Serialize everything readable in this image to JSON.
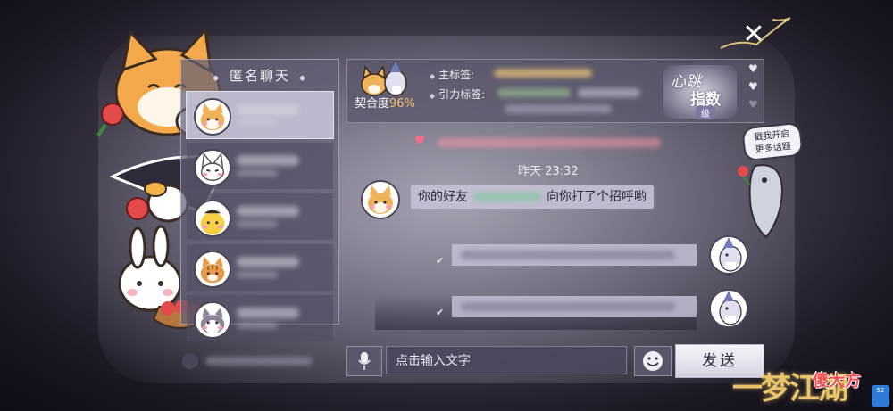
{
  "anonymous_chat": {
    "title": "匿名聊天",
    "contacts": [
      {
        "avatar": "shiba-dog-avatar",
        "selected": true
      },
      {
        "avatar": "white-fox-avatar",
        "selected": false
      },
      {
        "avatar": "yellow-chick-avatar",
        "selected": false
      },
      {
        "avatar": "tabby-cat-avatar",
        "selected": false
      },
      {
        "avatar": "husky-avatar",
        "selected": false
      }
    ]
  },
  "header": {
    "match_label": "契合度",
    "match_value": "96%",
    "main_tag_label": "主标签:",
    "gravity_tag_label": "引力标签:",
    "heartbeat_line1": "心跳",
    "heartbeat_line2": "指数",
    "heartbeat_level": "级"
  },
  "chat": {
    "timestamp": "昨天  23:32",
    "greeting_prefix": "你的好友",
    "greeting_suffix": "向你打了个招呼哟"
  },
  "input": {
    "placeholder": "点击输入文字",
    "send_label": "发送"
  },
  "hint_bubble": {
    "line1": "戳我开启",
    "line2": "更多话题"
  },
  "branding": {
    "game_logo": "一梦江湖",
    "watermark": "傻大方",
    "badge": "52"
  },
  "colors": {
    "match_percent": "#f3c46a",
    "send_button": "#e6e4ee",
    "accent_pink": "#ff6a8a"
  }
}
